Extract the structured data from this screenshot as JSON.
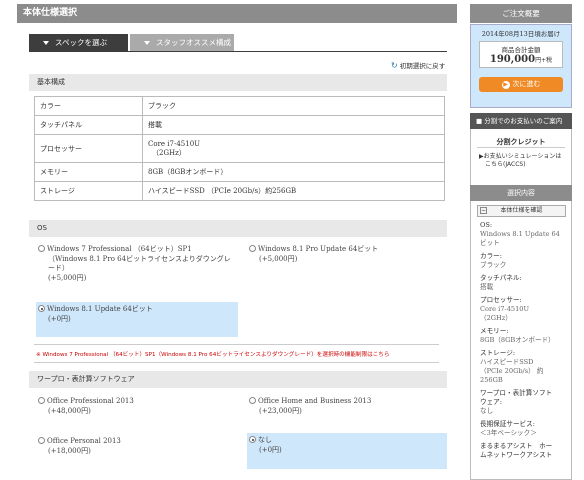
{
  "header": {
    "title": "本体仕様選択"
  },
  "tabs": [
    {
      "label": "スペックを選ぶ",
      "active": true
    },
    {
      "label": "スタッフオススメ構成",
      "active": false
    }
  ],
  "reset_link": "初期選択に戻す",
  "basic": {
    "title": "基本構成",
    "rows": [
      {
        "key": "カラー",
        "value": "ブラック"
      },
      {
        "key": "タッチパネル",
        "value": "搭載"
      },
      {
        "key": "プロセッサー",
        "value": "Core i7-4510U",
        "value2": "（2GHz）"
      },
      {
        "key": "メモリー",
        "value": "8GB（8GBオンボード）"
      },
      {
        "key": "ストレージ",
        "value": "ハイスピードSSD （PCIe 20Gb/s）約256GB"
      }
    ]
  },
  "os": {
    "title": "OS",
    "options": [
      {
        "line1": "Windows 7 Professional （64ビット）SP1",
        "line2": "（Windows 8.1 Pro 64ビットライセンスよりダウングレ",
        "line3": "ード）",
        "price": "(+5,000円)",
        "selected": false
      },
      {
        "line1": "Windows 8.1 Pro Update 64ビット",
        "price": "(+5,000円)",
        "selected": false
      },
      {
        "line1": "Windows 8.1 Update 64ビット",
        "price": "(+0円)",
        "selected": true
      }
    ],
    "note": "※ Windows 7 Professional （64ビット）SP1（Windows 8.1 Pro 64ビットライセンスよりダウングレード）を選択時の機能制限はこちら"
  },
  "office": {
    "title": "ワープロ・表計算ソフトウェア",
    "options": [
      {
        "line1": "Office Professional 2013",
        "price": "(+48,000円)",
        "selected": false
      },
      {
        "line1": "Office Home and Business 2013",
        "price": "(+23,000円)",
        "selected": false
      },
      {
        "line1": "Office Personal 2013",
        "price": "(+18,000円)",
        "selected": false
      },
      {
        "line1": "なし",
        "price": "(+0円)",
        "selected": true
      }
    ]
  },
  "sidebar": {
    "order_title": "ご注文概要",
    "date": "2014年08月13日頃お届け",
    "total_label": "商品合計金額",
    "total_value": "190,000",
    "total_suffix": "円+税",
    "next_button": "次に進む",
    "pay_title": "分割でのお支払いのご案内",
    "credit_title": "分割クレジット",
    "sim_line1": "▶お支払いシミュレーションは",
    "sim_line2": "こちら(JACCS)",
    "sel_title": "選択内容",
    "spec_confirm": "本体仕様を確認",
    "items": [
      {
        "k": "OS:",
        "v": [
          "Windows 8.1 Update 64",
          "ビット"
        ]
      },
      {
        "k": "カラー:",
        "v": [
          "ブラック"
        ]
      },
      {
        "k": "タッチパネル:",
        "v": [
          "搭載"
        ]
      },
      {
        "k": "プロセッサー:",
        "v": [
          "Core i7-4510U",
          "（2GHz）"
        ]
      },
      {
        "k": "メモリー:",
        "v": [
          "8GB（8GBオンボード）"
        ]
      },
      {
        "k": "ストレージ:",
        "v": [
          "ハイスピードSSD",
          "（PCIe 20Gb/s） 約",
          "256GB"
        ]
      },
      {
        "k": "ワープロ・表計算ソフト",
        "v": [
          "ウェア:",
          "なし"
        ]
      },
      {
        "k": "長期保証サービス:",
        "v": [
          "＜3年ベーシック＞"
        ]
      },
      {
        "k": "まるまるアシスト　ホー",
        "v": [
          "ムネットワークアシスト"
        ]
      }
    ]
  }
}
